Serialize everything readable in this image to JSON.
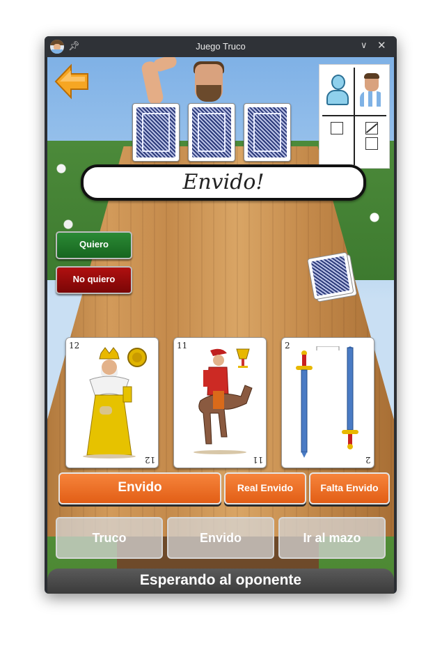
{
  "window": {
    "title": "Juego Truco"
  },
  "game": {
    "announcement": "Envido!",
    "response_buttons": {
      "accept": "Quiero",
      "decline": "No quiero"
    },
    "hand": [
      {
        "number": "12",
        "suit": "oros",
        "figure": "Rey"
      },
      {
        "number": "11",
        "suit": "copas",
        "figure": "Caballo"
      },
      {
        "number": "2",
        "suit": "espadas",
        "figure": ""
      }
    ],
    "envido_actions": {
      "envido": "Envido",
      "real_envido": "Real Envido",
      "falta_envido": "Falta Envido"
    },
    "disabled_actions": {
      "truco": "Truco",
      "envido": "Envido",
      "ir_al_mazo": "Ir al mazo"
    },
    "status": "Esperando al oponente",
    "opponent_cards_count": 3,
    "scoreboard": {
      "player_icon": "user-icon",
      "opponent_icon": "opponent-avatar-icon",
      "player_tallies": 1,
      "opponent_tallies": 2
    }
  },
  "colors": {
    "primary_action": "#f26f24",
    "accept": "#1f7a2a",
    "decline": "#9a0b0b",
    "status_bar": "#4a4a4a"
  }
}
